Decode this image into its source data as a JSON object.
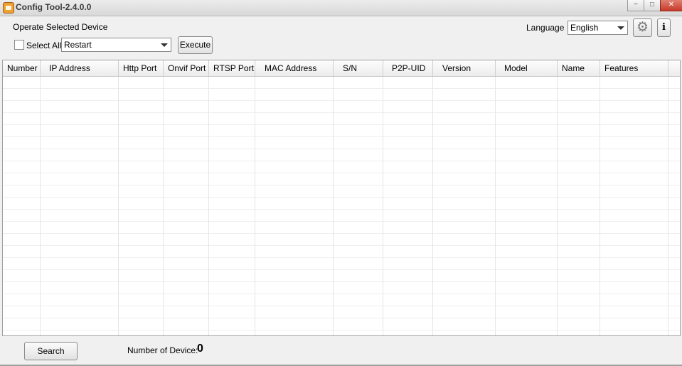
{
  "window": {
    "title": "Config Tool-2.4.0.0",
    "minimize_glyph": "−",
    "maximize_glyph": "□",
    "close_glyph": "✕"
  },
  "toolbar": {
    "operate_label": "Operate Selected Device",
    "select_all_label": "Select All",
    "action_value": "Restart",
    "execute_label": "Execute",
    "language_label": "Language",
    "language_value": "English",
    "settings_icon": "gear-icon",
    "info_label": "i"
  },
  "table": {
    "columns": [
      "Number",
      "IP Address",
      "Http Port",
      "Onvif Port",
      "RTSP Port",
      "MAC Address",
      "S/N",
      "P2P-UID",
      "Version",
      "Model",
      "Name",
      "Features"
    ],
    "rows": []
  },
  "footer": {
    "search_label": "Search",
    "device_count_label": "Number of Device:",
    "device_count": "0"
  }
}
